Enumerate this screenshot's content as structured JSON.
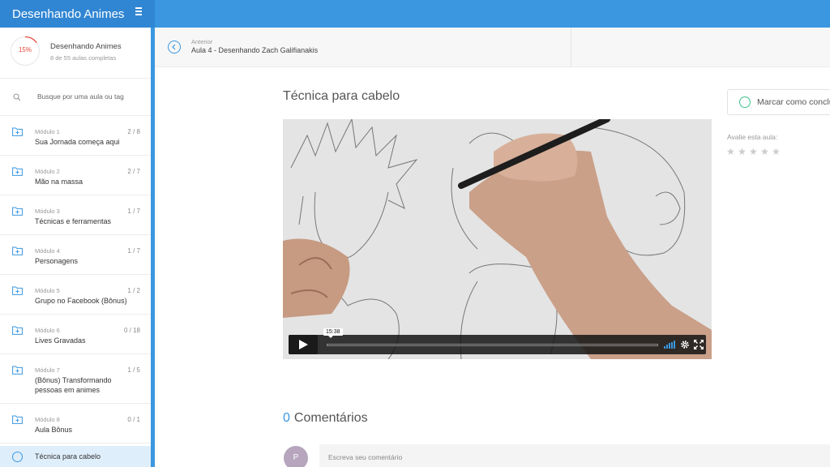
{
  "app": {
    "title": "Desenhando Animes"
  },
  "progress": {
    "percent_label": "15%",
    "percent": 0.15,
    "course_name": "Desenhando Animes",
    "completed_text": "8 de 55 aulas completas"
  },
  "search": {
    "placeholder": "Busque por uma aula ou tag"
  },
  "modules": [
    {
      "label": "Módulo 1",
      "count": "2 / 8",
      "title": "Sua Jornada começa aqui"
    },
    {
      "label": "Módulo 2",
      "count": "2 / 7",
      "title": "Mão na massa"
    },
    {
      "label": "Módulo 3",
      "count": "1 / 7",
      "title": "Técnicas e ferramentas"
    },
    {
      "label": "Módulo 4",
      "count": "1 / 7",
      "title": "Personagens"
    },
    {
      "label": "Módulo 5",
      "count": "1 / 2",
      "title": "Grupo no Facebook (Bônus)"
    },
    {
      "label": "Módulo 6",
      "count": "0 / 18",
      "title": "Lives Gravadas"
    },
    {
      "label": "Módulo 7",
      "count": "1 / 5",
      "title": "(Bônus) Transformando pessoas em animes"
    },
    {
      "label": "Módulo 8",
      "count": "0 / 1",
      "title": "Aula Bônus"
    }
  ],
  "active_lesson": {
    "title": "Técnica para cabelo"
  },
  "nav": {
    "prev_label": "Anterior",
    "prev_title": "Aula 4 - Desenhando Zach Galifianakis"
  },
  "lesson": {
    "title": "Técnica para cabelo"
  },
  "video": {
    "time_tooltip": "15:38"
  },
  "actions": {
    "mark_complete": "Marcar como concluída",
    "rate_label": "Avalie esta aula:",
    "rating": 0,
    "max_rating": 5
  },
  "comments": {
    "count": "0",
    "title": "Comentários",
    "avatar_initial": "P",
    "placeholder": "Escreva seu comentário"
  },
  "colors": {
    "accent": "#3a97e0",
    "progress_red": "#e9473b",
    "complete_green": "#3ec28a"
  }
}
